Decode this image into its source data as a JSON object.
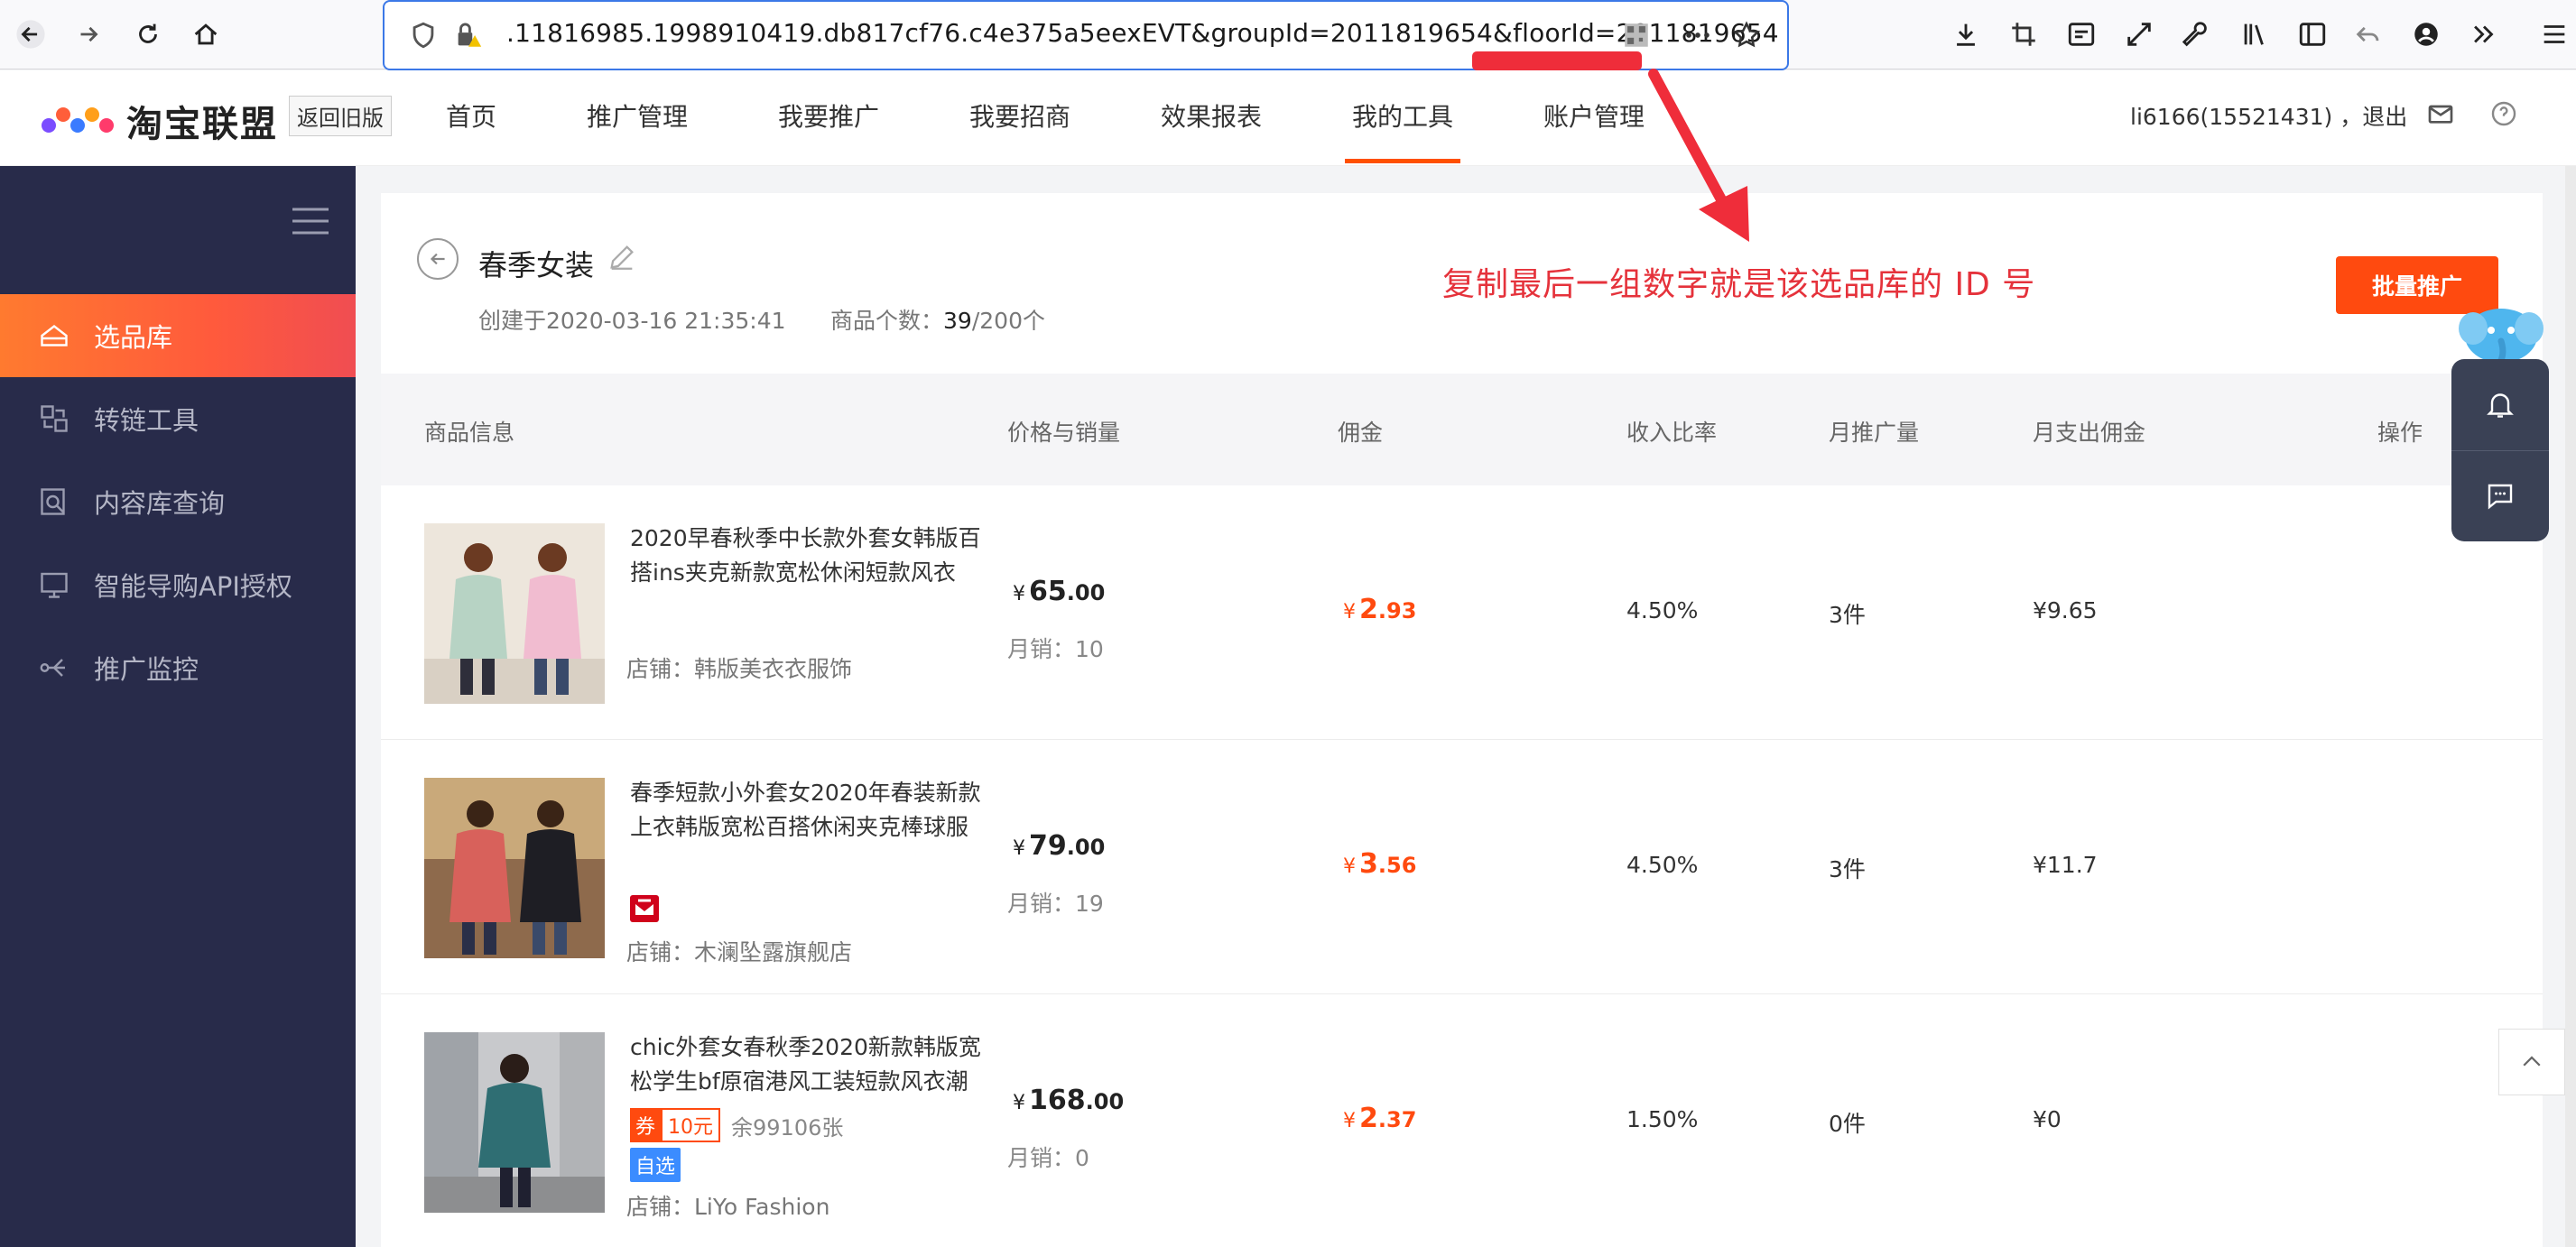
{
  "browser": {
    "url": ".11816985.1998910419.db817cf76.c4e375a5eexEVT&groupId=2011819654&floorId=2011819654"
  },
  "header": {
    "logo_text": "淘宝联盟",
    "old_version": "返回旧版",
    "nav": [
      "首页",
      "推广管理",
      "我要推广",
      "我要招商",
      "效果报表",
      "我的工具",
      "账户管理"
    ],
    "active_nav": "我的工具",
    "user": "li6166(15521431) ，退出"
  },
  "sidebar": {
    "items": [
      {
        "label": "选品库",
        "active": true
      },
      {
        "label": "转链工具",
        "active": false
      },
      {
        "label": "内容库查询",
        "active": false
      },
      {
        "label": "智能导购API授权",
        "active": false
      },
      {
        "label": "推广监控",
        "active": false
      }
    ]
  },
  "library": {
    "title": "春季女装",
    "created": "创建于2020-03-16 21:35:41",
    "count_label": "商品个数：",
    "count": "39",
    "count_max": "/200个",
    "batch_button": "批量推广"
  },
  "annotation": "复制最后一组数字就是该选品库的 ID 号",
  "table": {
    "headers": [
      "商品信息",
      "价格与销量",
      "佣金",
      "收入比率",
      "月推广量",
      "月支出佣金",
      "操作"
    ],
    "rows": [
      {
        "title": "2020早春秋季中长款外套女韩版百搭ins夹克新款宽松休闲短款风衣",
        "shop": "店铺：韩版美衣衣服饰",
        "price_yen": "¥",
        "price_int": "65",
        "price_dec": ".00",
        "sales": "月销：10",
        "comm_yen": "¥",
        "comm_int": "2",
        "comm_dec": ".93",
        "rate": "4.50%",
        "month": "3件",
        "spend": "¥9.65"
      },
      {
        "title": "春季短款小外套女2020年春装新款上衣韩版宽松百搭休闲夹克棒球服",
        "shop": "店铺：木澜坠露旗舰店",
        "price_yen": "¥",
        "price_int": "79",
        "price_dec": ".00",
        "sales": "月销：19",
        "comm_yen": "¥",
        "comm_int": "3",
        "comm_dec": ".56",
        "rate": "4.50%",
        "month": "3件",
        "spend": "¥11.7"
      },
      {
        "title": "chic外套女春秋季2020新款韩版宽松学生bf原宿港风工装短款风衣潮",
        "shop": "店铺：LiYo Fashion",
        "coupon_tag": "券",
        "coupon_value": "10元",
        "coupon_left": "余99106张",
        "self_tag": "自选",
        "price_yen": "¥",
        "price_int": "168",
        "price_dec": ".00",
        "sales": "月销：0",
        "comm_yen": "¥",
        "comm_int": "2",
        "comm_dec": ".37",
        "rate": "1.50%",
        "month": "0件",
        "spend": "¥0"
      }
    ]
  },
  "colors": {
    "accent": "#ff4a0f",
    "sidebar_bg": "#282b4a",
    "annotation": "#e5323b",
    "url_border": "#3b78e7"
  }
}
